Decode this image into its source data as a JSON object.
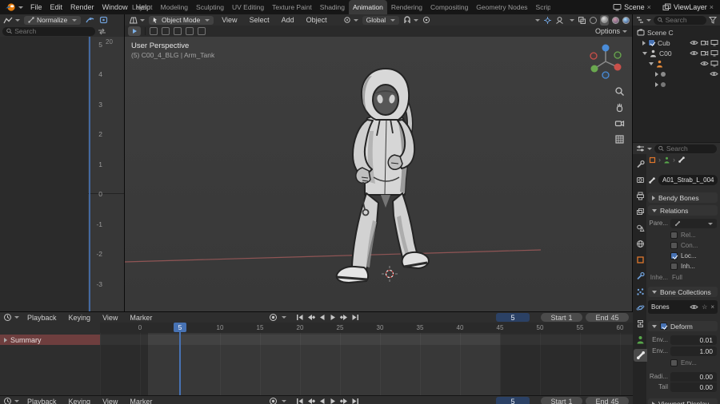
{
  "topbar": {
    "menus": [
      "File",
      "Edit",
      "Render",
      "Window",
      "Help"
    ],
    "tabs": [
      "Layout",
      "Modeling",
      "Sculpting",
      "UV Editing",
      "Texture Paint",
      "Shading",
      "Animation",
      "Rendering",
      "Compositing",
      "Geometry Nodes",
      "Scripting",
      "+"
    ],
    "scene_label": "Scene",
    "view_layer_label": "ViewLayer",
    "close_glyph": "×"
  },
  "graph_editor": {
    "normalize_label": "Normalize",
    "search_placeholder": "Search",
    "ruler_frame": "20",
    "y_axis": [
      "5",
      "4",
      "3",
      "2",
      "1",
      "0",
      "-1",
      "-2",
      "-3"
    ]
  },
  "viewport": {
    "mode": "Object Mode",
    "menus": [
      "View",
      "Select",
      "Add",
      "Object"
    ],
    "orientation": "Global",
    "options_label": "Options",
    "overlay": {
      "line1": "User Perspective",
      "line2": "(5) C00_4_BLG | Arm_Tank"
    }
  },
  "outliner": {
    "search_placeholder": "Search",
    "rows": [
      {
        "label": "Scene C"
      },
      {
        "label": "Cub"
      },
      {
        "label": "C00"
      }
    ]
  },
  "properties": {
    "search_placeholder": "Search",
    "bone_name": "A01_Strab_L_004",
    "sections": {
      "bendy_bones": "Bendy Bones",
      "relations": "Relations",
      "bone_collections": "Bone Collections",
      "deform": "Deform",
      "viewport_display": "Viewport Display"
    },
    "relations": {
      "parent_label": "Pare...",
      "relative_label": "Rel...",
      "connected_label": "Con...",
      "local_location_label": "Loc...",
      "inherit_rotation_label": "Inh...",
      "inherit_scale_label": "Inhe...",
      "inherit_scale_value": "Full"
    },
    "bone_collections": {
      "list_item": "Bones"
    },
    "deform": {
      "envelope_distance_label": "Env...",
      "envelope_distance_value": "0.01",
      "envelope_weight_label": "Env...",
      "envelope_weight_value": "1.00",
      "envelope_multiply_label": "Env...",
      "radius_head_label": "Radi...",
      "radius_head_value": "0.00",
      "tail_label": "Tail",
      "tail_value": "0.00"
    }
  },
  "timeline": {
    "menus": [
      "Playback",
      "Keying",
      "View",
      "Marker"
    ],
    "ruler": [
      "0",
      "5",
      "10",
      "15",
      "20",
      "25",
      "30",
      "35",
      "40",
      "45",
      "50",
      "55",
      "60"
    ],
    "current_frame": "5",
    "playhead_label": "5",
    "start_label": "Start",
    "start_value": "1",
    "end_label": "End",
    "end_value": "45",
    "summary_label": "Summary"
  },
  "timeline2": {
    "menus": [
      "Playback",
      "Keying",
      "View",
      "Marker"
    ],
    "current_frame": "5",
    "start_label": "Start",
    "start_value": "1",
    "end_label": "End",
    "end_value": "45"
  },
  "colors": {
    "accent_blue": "#4772b3",
    "summary_red": "#6e3e3e",
    "armature_orange": "#e58a3a",
    "axis_red": "#a05a5a"
  }
}
